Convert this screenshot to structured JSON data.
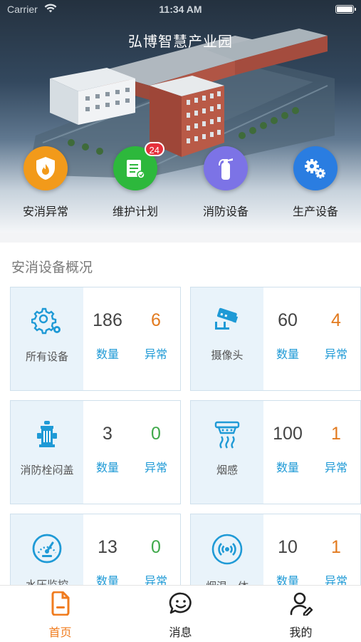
{
  "status_bar": {
    "carrier": "Carrier",
    "time": "11:34 AM"
  },
  "header": {
    "title": "弘博智慧产业园"
  },
  "quick_actions": [
    {
      "label": "安消异常",
      "icon": "fire-shield-icon",
      "color": "#f29a1a"
    },
    {
      "label": "维护计划",
      "icon": "maintenance-plan-icon",
      "color": "#2db83c",
      "badge": "24"
    },
    {
      "label": "消防设备",
      "icon": "fire-extinguisher-icon",
      "color": "#7c73e6"
    },
    {
      "label": "生产设备",
      "icon": "gears-icon",
      "color": "#2a7de1"
    }
  ],
  "overview": {
    "title": "安消设备概况",
    "count_label": "数量",
    "abnormal_label": "异常",
    "cards": [
      {
        "name": "所有设备",
        "icon": "gear-settings-icon",
        "count": "186",
        "abnormal": "6"
      },
      {
        "name": "摄像头",
        "icon": "camera-icon",
        "count": "60",
        "abnormal": "4"
      },
      {
        "name": "消防栓闷盖",
        "icon": "fire-hydrant-icon",
        "count": "3",
        "abnormal": "0"
      },
      {
        "name": "烟感",
        "icon": "smoke-detector-icon",
        "count": "100",
        "abnormal": "1"
      },
      {
        "name": "水压监控",
        "icon": "pressure-gauge-icon",
        "count": "13",
        "abnormal": "0"
      },
      {
        "name": "烟温一体",
        "icon": "smoke-temperature-sensor-icon",
        "count": "10",
        "abnormal": "1"
      }
    ]
  },
  "tabbar": {
    "items": [
      {
        "label": "首页",
        "icon": "home-document-icon",
        "active": true
      },
      {
        "label": "消息",
        "icon": "message-bubble-icon",
        "active": false
      },
      {
        "label": "我的",
        "icon": "profile-icon",
        "active": false
      }
    ],
    "active_color": "#f07c1f"
  }
}
